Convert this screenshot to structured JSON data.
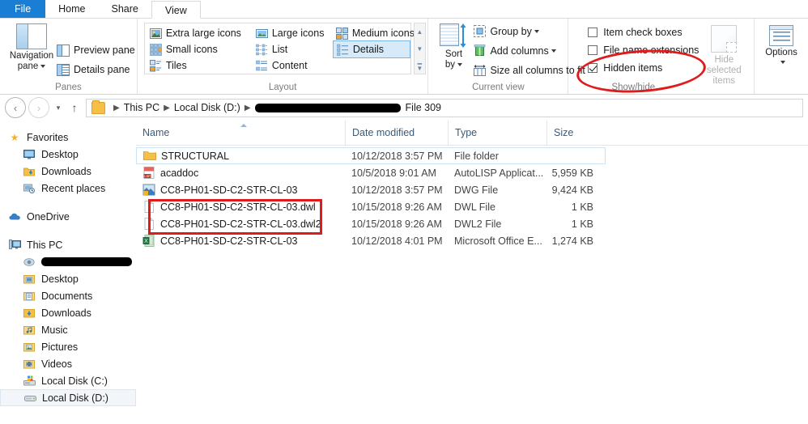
{
  "window": {
    "tabs": [
      {
        "label": "File",
        "state": "file"
      },
      {
        "label": "Home",
        "state": "normal"
      },
      {
        "label": "Share",
        "state": "normal"
      },
      {
        "label": "View",
        "state": "active"
      }
    ]
  },
  "ribbon": {
    "panes": {
      "group_label": "Panes",
      "navigation_pane": "Navigation\npane",
      "navigation_pane_line1": "Navigation",
      "navigation_pane_line2": "pane",
      "preview_pane": "Preview pane",
      "details_pane": "Details pane"
    },
    "layout": {
      "group_label": "Layout",
      "items": [
        {
          "label": "Extra large icons",
          "selected": false
        },
        {
          "label": "Large icons",
          "selected": false
        },
        {
          "label": "Medium icons",
          "selected": false
        },
        {
          "label": "Small icons",
          "selected": false
        },
        {
          "label": "List",
          "selected": false
        },
        {
          "label": "Details",
          "selected": true
        },
        {
          "label": "Tiles",
          "selected": false
        },
        {
          "label": "Content",
          "selected": false
        }
      ]
    },
    "current_view": {
      "group_label": "Current view",
      "sort_by_line1": "Sort",
      "sort_by_line2": "by",
      "group_by": "Group by",
      "add_columns": "Add columns",
      "size_all_columns": "Size all columns to fit"
    },
    "show_hide": {
      "group_label": "Show/hide",
      "item_check_boxes": {
        "label": "Item check boxes",
        "checked": false
      },
      "file_name_extensions": {
        "label": "File name extensions",
        "checked": false
      },
      "hidden_items": {
        "label": "Hidden items",
        "checked": true
      },
      "hide_selected_line1": "Hide selected",
      "hide_selected_line2": "items"
    },
    "options": {
      "label": "Options"
    }
  },
  "address_bar": {
    "back": "‹",
    "forward": "›",
    "recent": "▾",
    "up": "↑",
    "breadcrumbs": [
      {
        "label": "This PC",
        "redacted": false
      },
      {
        "label": "Local Disk (D:)",
        "redacted": false
      },
      {
        "label": "",
        "redacted": true
      },
      {
        "label": "File 309",
        "redacted": false
      }
    ]
  },
  "sidebar": {
    "sections": [
      {
        "header": {
          "label": "Favorites",
          "icon": "star-icon",
          "color": "#f5b221"
        },
        "items": [
          {
            "label": "Desktop",
            "icon": "monitor-icon"
          },
          {
            "label": "Downloads",
            "icon": "download-folder-icon"
          },
          {
            "label": "Recent places",
            "icon": "recent-places-icon"
          }
        ]
      },
      {
        "header": {
          "label": "OneDrive",
          "icon": "cloud-icon",
          "color": "#3a7fc2"
        },
        "items": []
      },
      {
        "header": {
          "label": "This PC",
          "icon": "computer-icon",
          "color": "#5b8fb9"
        },
        "items": [
          {
            "label": "",
            "icon": "cloud-sync-icon",
            "redacted": true
          },
          {
            "label": "Desktop",
            "icon": "desktop-folder-icon"
          },
          {
            "label": "Documents",
            "icon": "documents-folder-icon"
          },
          {
            "label": "Downloads",
            "icon": "download-folder-icon"
          },
          {
            "label": "Music",
            "icon": "music-folder-icon"
          },
          {
            "label": "Pictures",
            "icon": "pictures-folder-icon"
          },
          {
            "label": "Videos",
            "icon": "videos-folder-icon"
          },
          {
            "label": "Local Disk (C:)",
            "icon": "system-drive-icon"
          },
          {
            "label": "Local Disk (D:)",
            "icon": "drive-icon",
            "selected": true
          }
        ]
      }
    ]
  },
  "file_list": {
    "columns": [
      {
        "label": "Name",
        "sorted": "asc"
      },
      {
        "label": "Date modified",
        "sorted": ""
      },
      {
        "label": "Type",
        "sorted": ""
      },
      {
        "label": "Size",
        "sorted": ""
      }
    ],
    "rows": [
      {
        "name": "STRUCTURAL",
        "date_modified": "10/12/2018 3:57 PM",
        "type": "File folder",
        "size": "",
        "icon": "folder-icon",
        "hover": true
      },
      {
        "name": "acaddoc",
        "date_modified": "10/5/2018 9:01 AM",
        "type": "AutoLISP Applicat...",
        "size": "5,959 KB",
        "icon": "lisp-file-icon",
        "hover": false
      },
      {
        "name": "CC8-PH01-SD-C2-STR-CL-03",
        "date_modified": "10/12/2018 3:57 PM",
        "type": "DWG File",
        "size": "9,424 KB",
        "icon": "dwg-file-icon",
        "hover": false
      },
      {
        "name": "CC8-PH01-SD-C2-STR-CL-03.dwl",
        "date_modified": "10/15/2018 9:26 AM",
        "type": "DWL File",
        "size": "1 KB",
        "icon": "blank-file-icon",
        "hover": false
      },
      {
        "name": "CC8-PH01-SD-C2-STR-CL-03.dwl2",
        "date_modified": "10/15/2018 9:26 AM",
        "type": "DWL2 File",
        "size": "1 KB",
        "icon": "blank-file-icon",
        "hover": false
      },
      {
        "name": "CC8-PH01-SD-C2-STR-CL-03",
        "date_modified": "10/12/2018 4:01 PM",
        "type": "Microsoft Office E...",
        "size": "1,274 KB",
        "icon": "excel-file-icon",
        "hover": false
      }
    ]
  },
  "annotations": {
    "color": "#e01b1b",
    "rectangle_target": "dwl-and-dwl2-rows",
    "ellipse_target": "hidden-items-checkbox"
  }
}
